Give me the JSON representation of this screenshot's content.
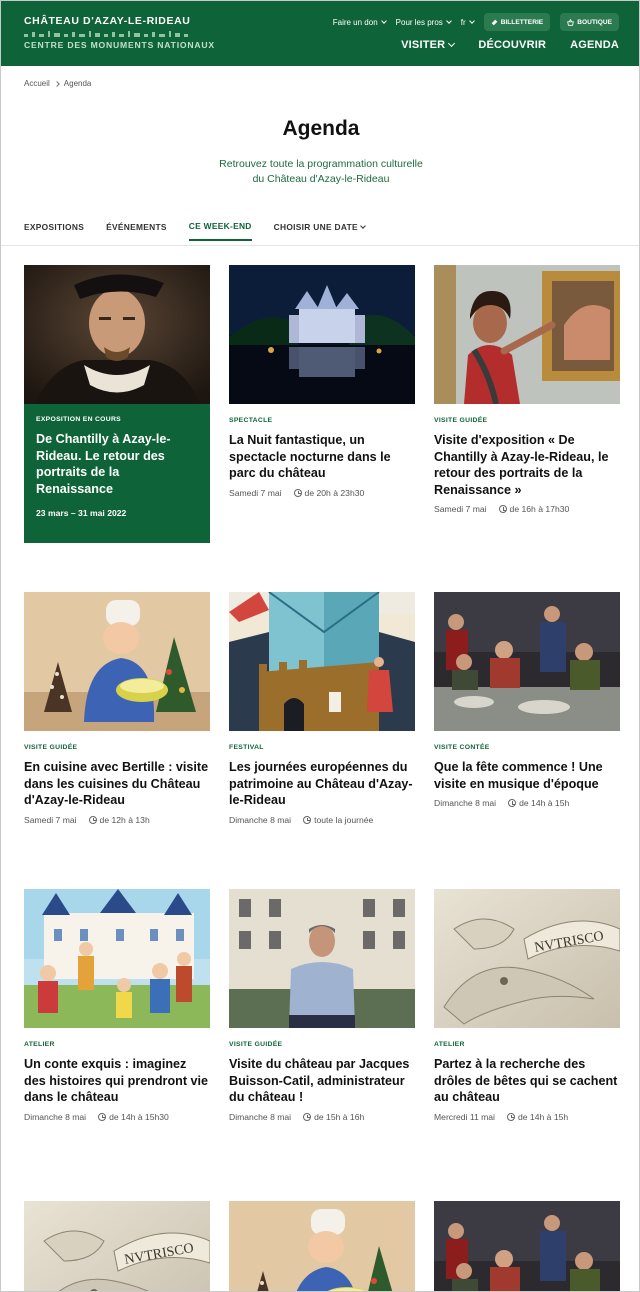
{
  "header": {
    "brand_title": "CHÂTEAU D'AZAY-LE-RIDEAU",
    "brand_sub": "CENTRE DES MONUMENTS NATIONAUX",
    "top_links": [
      "Faire un don",
      "Pour les pros",
      "fr"
    ],
    "ticket_label": "BILLETTERIE",
    "shop_label": "BOUTIQUE",
    "nav": [
      "VISITER",
      "DÉCOUVRIR",
      "AGENDA"
    ],
    "colors": {
      "primary": "#0f6338",
      "pill": "#2c7a50"
    }
  },
  "breadcrumb": {
    "home": "Accueil",
    "current": "Agenda"
  },
  "page": {
    "title": "Agenda",
    "subtitle_line1": "Retrouvez toute la programmation culturelle",
    "subtitle_line2": "du Château d'Azay-le-Rideau"
  },
  "tabs": [
    "EXPOSITIONS",
    "ÉVÉNEMENTS",
    "CE WEEK-END",
    "CHOISIR UNE DATE"
  ],
  "active_tab": "CE WEEK-END",
  "cards": [
    {
      "category": "EXPOSITION EN COURS",
      "title": "De Chantilly à Azay-le-Rideau. Le retour des portraits de la Renaissance",
      "date": "23 mars – 31 mai 2022",
      "time": "",
      "image": "portrait"
    },
    {
      "category": "SPECTACLE",
      "title": "La Nuit fantastique, un spectacle nocturne dans le parc du château",
      "date": "Samedi 7 mai",
      "time": "de 20h à 23h30",
      "image": "night-castle"
    },
    {
      "category": "VISITE GUIDÉE",
      "title": "Visite d'exposition « De Chantilly à Azay-le-Rideau, le retour des portraits de la Renaissance »",
      "date": "Samedi 7 mai",
      "time": "de 16h à 17h30",
      "image": "guide"
    },
    {
      "category": "VISITE GUIDÉE",
      "title": "En cuisine avec Bertille : visite dans les cuisines du Château d'Azay-le-Rideau",
      "date": "Samedi 7 mai",
      "time": "de 12h à 13h",
      "image": "cook"
    },
    {
      "category": "FESTIVAL",
      "title": "Les journées européennes du patrimoine au Château d'Azay-le-Rideau",
      "date": "Dimanche 8 mai",
      "time": "toute la journée",
      "image": "heritage"
    },
    {
      "category": "VISITE CONTÉE",
      "title": "Que la fête commence ! Une visite en musique d'époque",
      "date": "Dimanche 8 mai",
      "time": "de 14h à 15h",
      "image": "feast"
    },
    {
      "category": "ATELIER",
      "title": "Un conte exquis : imaginez des histoires qui prendront vie dans le château",
      "date": "Dimanche 8 mai",
      "time": "de 14h à 15h30",
      "image": "tale"
    },
    {
      "category": "VISITE GUIDÉE",
      "title": "Visite du château par Jacques Buisson-Catil, administrateur du château !",
      "date": "Dimanche 8 mai",
      "time": "de 15h à 16h",
      "image": "man"
    },
    {
      "category": "ATELIER",
      "title": "Partez à la recherche des drôles de bêtes qui se cachent au château",
      "date": "Mercredi 11 mai",
      "time": "de 14h à 15h",
      "image": "salamander"
    },
    {
      "category": "",
      "title": "",
      "date": "",
      "time": "",
      "image": "salamander"
    },
    {
      "category": "",
      "title": "",
      "date": "",
      "time": "",
      "image": "cook"
    },
    {
      "category": "",
      "title": "",
      "date": "",
      "time": "",
      "image": "feast"
    }
  ],
  "image_text": {
    "salamander_motto": "NVTRISCO"
  }
}
